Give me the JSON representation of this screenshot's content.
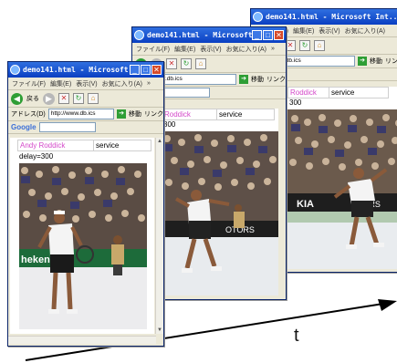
{
  "browser": {
    "window_title": "demo141.html - Microsoft Int...",
    "menu_items": [
      "ファイル(F)",
      "編集(E)",
      "表示(V)",
      "お気に入り(A)"
    ],
    "menu_more": "»",
    "toolbar_back_label": "戻る",
    "address_label": "アドレス(D)",
    "address_url": "http://www.db.ics",
    "go_label": "移動",
    "links_label": "リンク",
    "google_label": "Google"
  },
  "frames": [
    {
      "player_name": "Andy Roddick",
      "status_label": "service",
      "delay_text": "delay=300"
    },
    {
      "player_name": "Roddick",
      "status_label": "service",
      "delay_text": "300"
    },
    {
      "player_name": "Roddick",
      "status_label": "service",
      "delay_text": "300"
    }
  ],
  "figure": {
    "time_axis_label": "t"
  }
}
